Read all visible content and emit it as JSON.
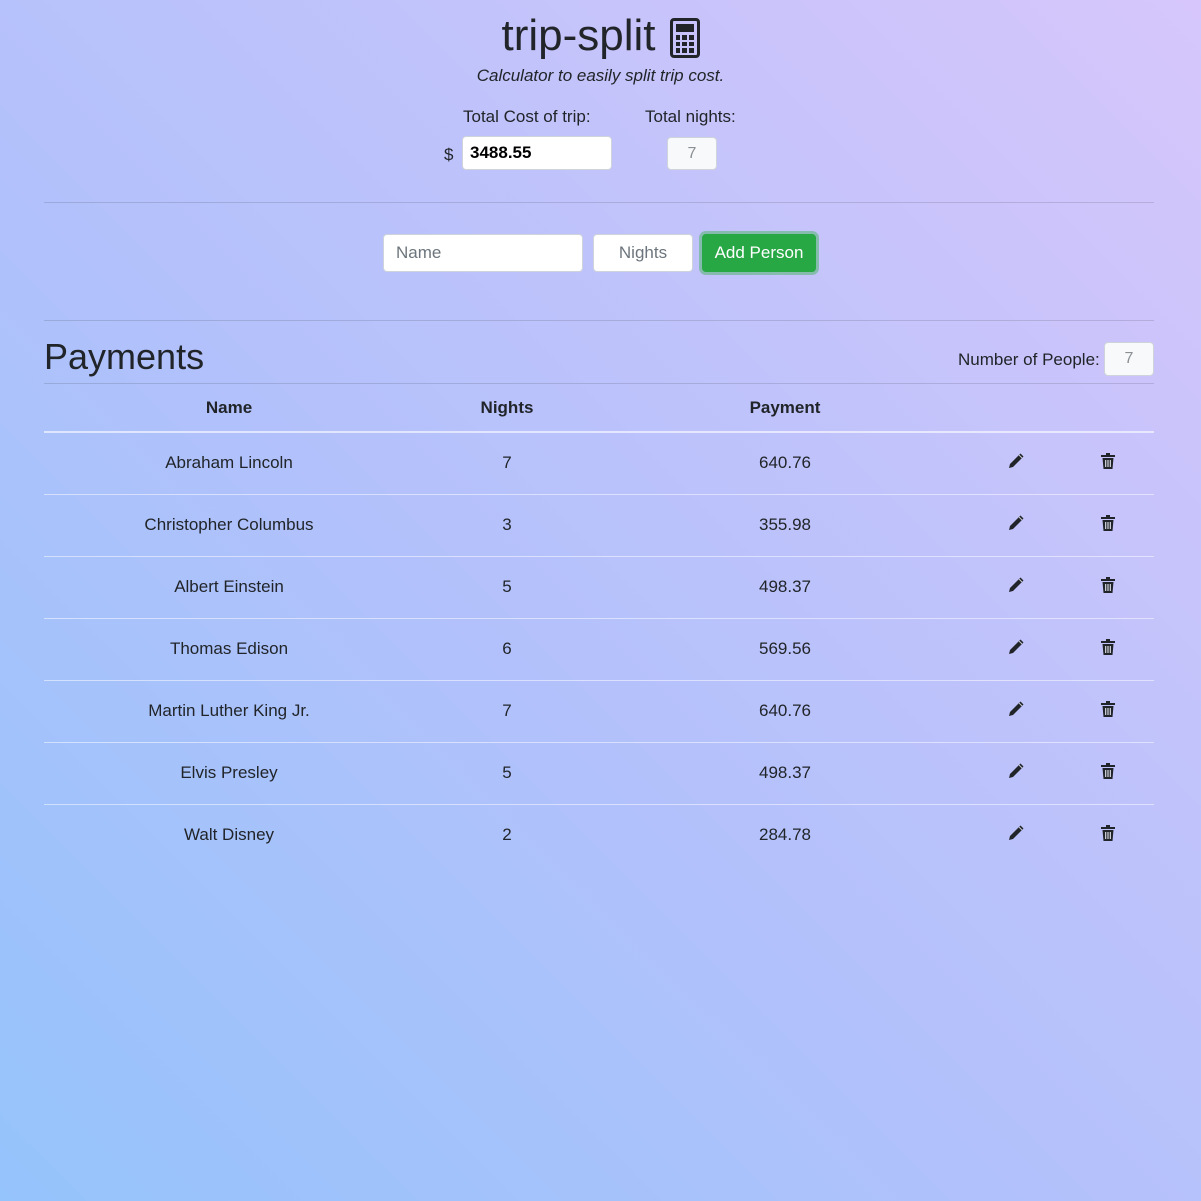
{
  "header": {
    "title": "trip-split",
    "subtitle": "Calculator to easily split trip cost."
  },
  "totals": {
    "cost_label": "Total Cost of trip:",
    "currency_symbol": "$",
    "cost_value": "3488.55",
    "nights_label": "Total nights:",
    "nights_value": "7"
  },
  "add_person": {
    "name_placeholder": "Name",
    "nights_placeholder": "Nights",
    "button_label": "Add Person"
  },
  "payments": {
    "title": "Payments",
    "people_label": "Number of People:",
    "people_count": "7",
    "columns": [
      "Name",
      "Nights",
      "Payment"
    ],
    "rows": [
      {
        "name": "Abraham Lincoln",
        "nights": "7",
        "payment": "640.76"
      },
      {
        "name": "Christopher Columbus",
        "nights": "3",
        "payment": "355.98"
      },
      {
        "name": "Albert Einstein",
        "nights": "5",
        "payment": "498.37"
      },
      {
        "name": "Thomas Edison",
        "nights": "6",
        "payment": "569.56"
      },
      {
        "name": "Martin Luther King Jr.",
        "nights": "7",
        "payment": "640.76"
      },
      {
        "name": "Elvis Presley",
        "nights": "5",
        "payment": "498.37"
      },
      {
        "name": "Walt Disney",
        "nights": "2",
        "payment": "284.78"
      }
    ]
  },
  "icons": {
    "title_icon": "calculator-icon",
    "edit": "pencil-icon",
    "delete": "trash-icon"
  },
  "colors": {
    "accent_button": "#28a745"
  }
}
